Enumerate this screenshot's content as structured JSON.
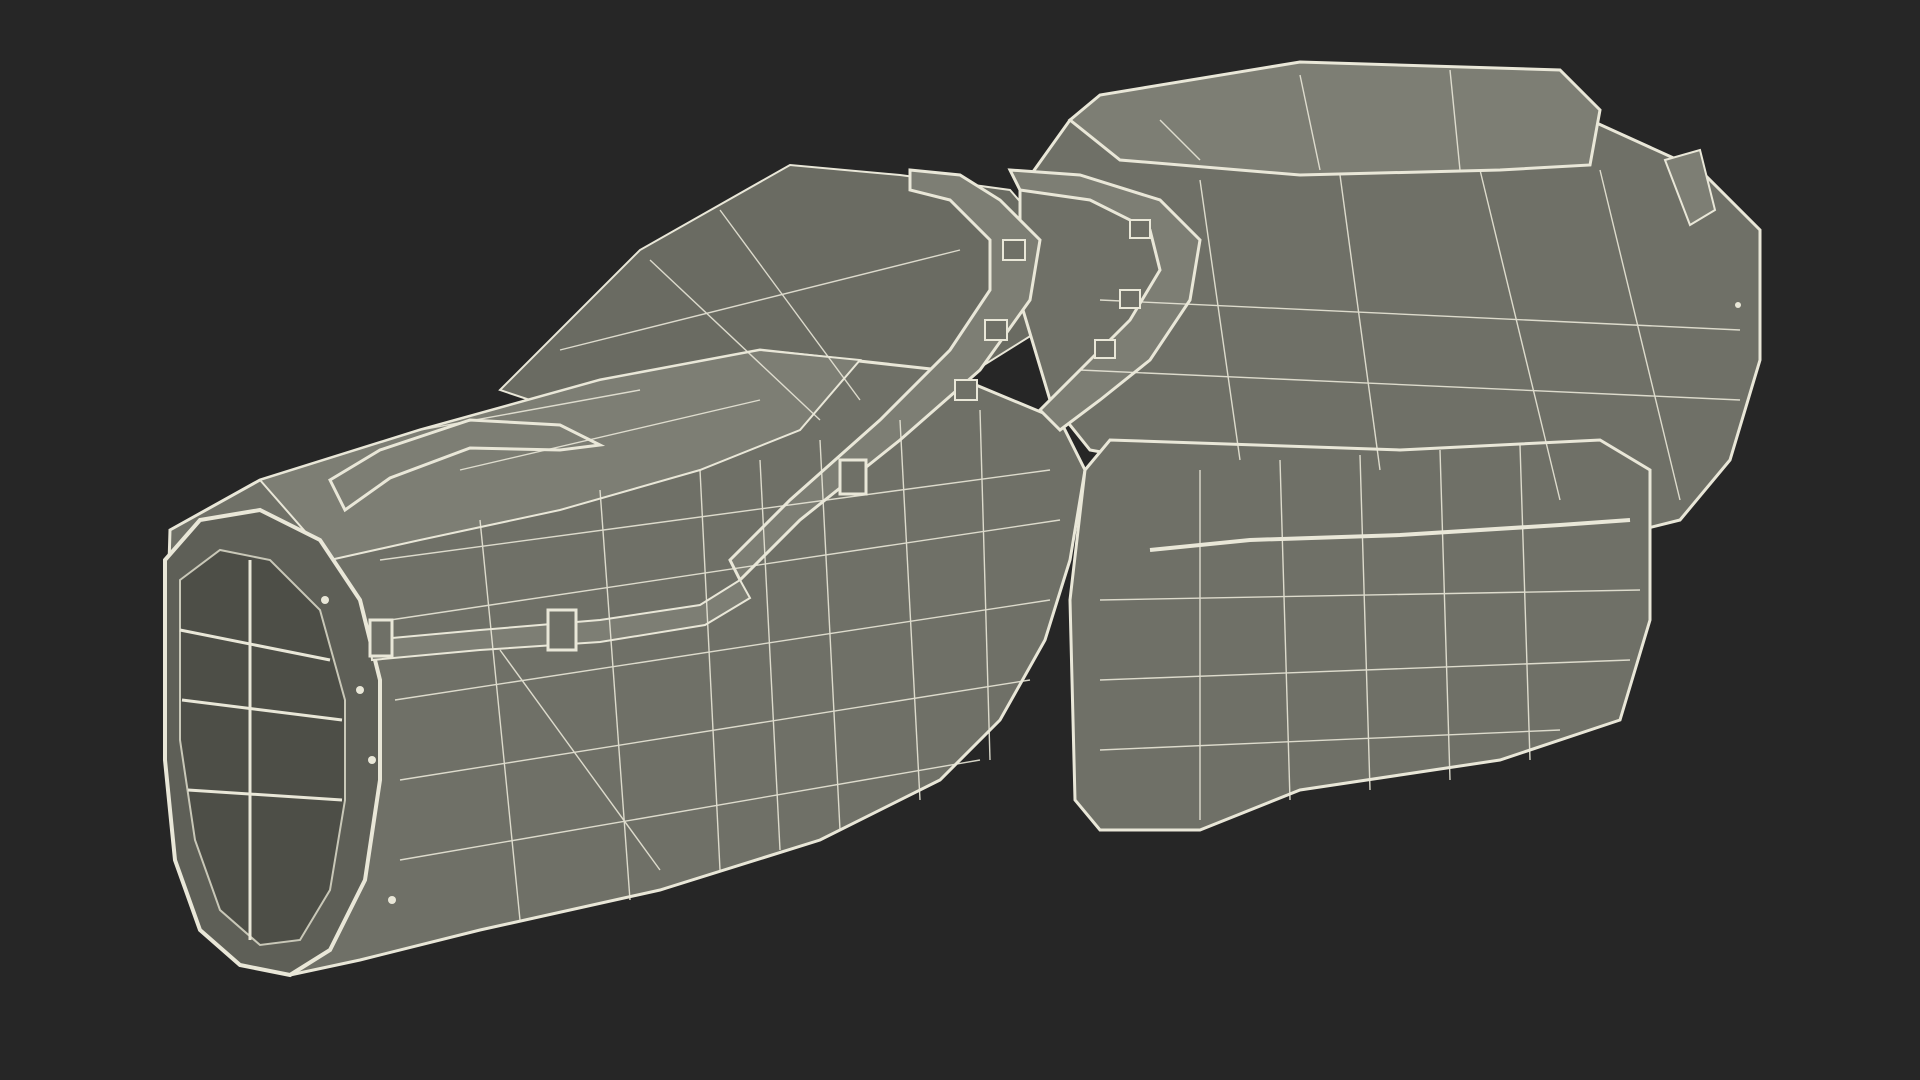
{
  "scene": {
    "subject": "golf-bag-wireframe-model",
    "colors": {
      "background": "#262626",
      "surface": "#6f7067",
      "surface_dark": "#55564e",
      "surface_light": "#7d7e74",
      "wire": "#e9e7d8",
      "wire_dim": "#c9c8b8"
    }
  }
}
